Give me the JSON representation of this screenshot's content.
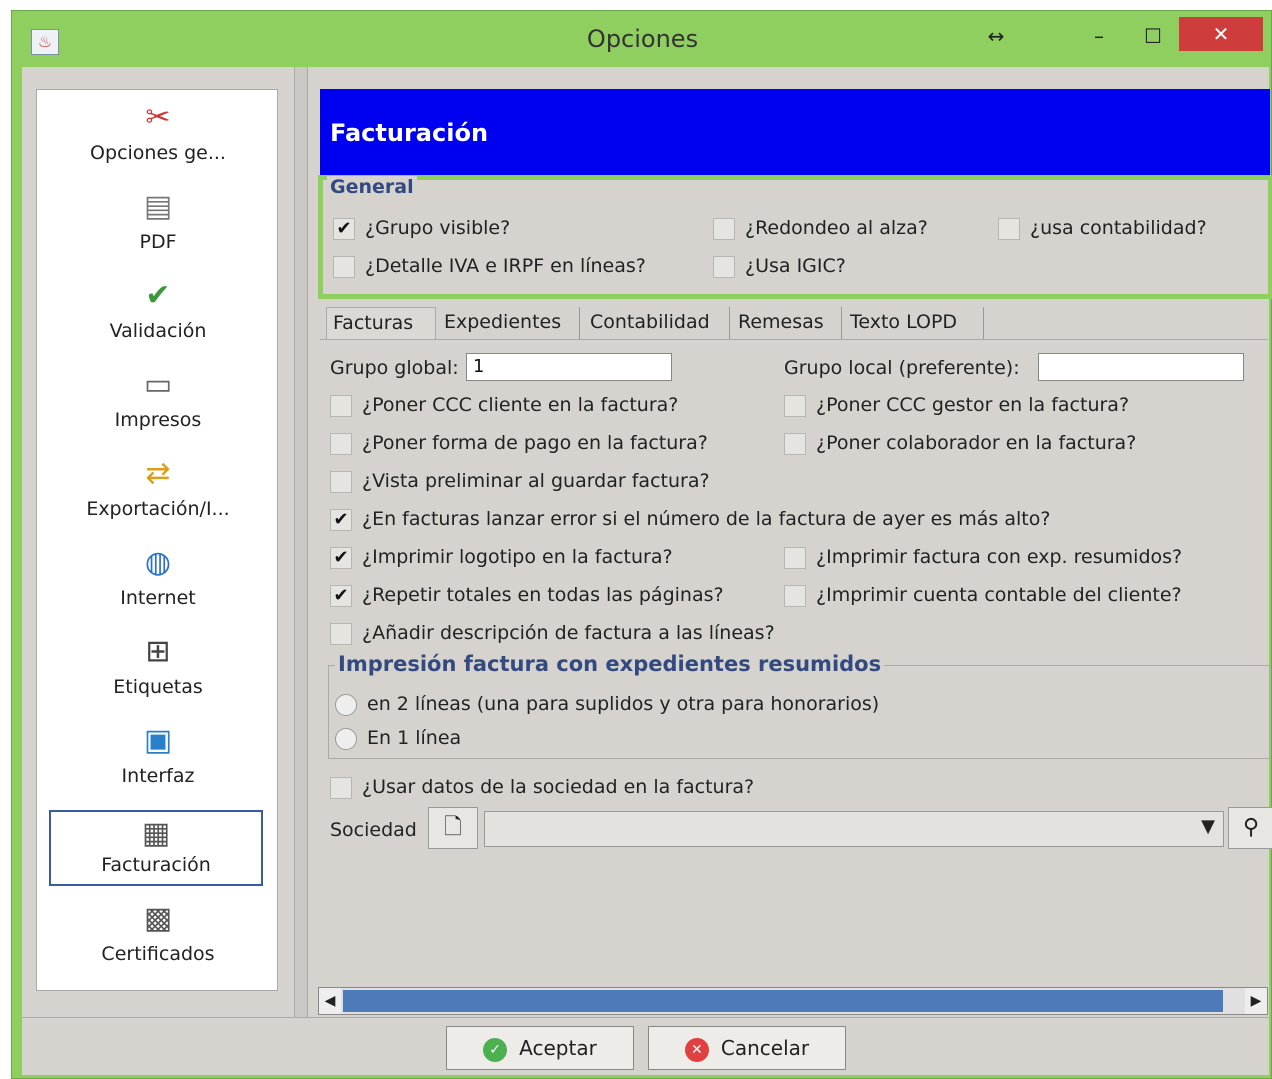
{
  "window": {
    "title": "Opciones",
    "close_glyph": "✕",
    "resize_glyph": "↔",
    "minimize_glyph": "–",
    "maximize_glyph": "☐"
  },
  "sidebar": {
    "items": [
      {
        "label": "Opciones ge...",
        "icon": "tools-icon",
        "glyph": "✂"
      },
      {
        "label": "PDF",
        "icon": "document-icon",
        "glyph": "▤"
      },
      {
        "label": "Validación",
        "icon": "checkmark-icon",
        "glyph": "✔"
      },
      {
        "label": "Impresos",
        "icon": "printer-icon",
        "glyph": "▭"
      },
      {
        "label": "Exportación/I...",
        "icon": "export-icon",
        "glyph": "⇄"
      },
      {
        "label": "Internet",
        "icon": "globe-icon",
        "glyph": "◍"
      },
      {
        "label": "Etiquetas",
        "icon": "label-icon",
        "glyph": "⊞"
      },
      {
        "label": "Interfaz",
        "icon": "interface-icon",
        "glyph": "▣"
      },
      {
        "label": "Facturación",
        "icon": "invoice-icon",
        "glyph": "▦"
      },
      {
        "label": "Certificados",
        "icon": "certificate-icon",
        "glyph": "▩"
      }
    ],
    "selected": "Facturación"
  },
  "banner": {
    "title": "Facturación"
  },
  "general": {
    "legend": "General",
    "grupo_visible": {
      "label": "¿Grupo visible?",
      "checked": true
    },
    "redondeo": {
      "label": "¿Redondeo al alza?",
      "checked": false
    },
    "usa_contabilidad": {
      "label": "¿usa contabilidad?",
      "checked": false
    },
    "detalle_iva": {
      "label": "¿Detalle IVA e IRPF en líneas?",
      "checked": false
    },
    "usa_igic": {
      "label": "¿Usa IGIC?",
      "checked": false
    }
  },
  "tabs": [
    "Facturas",
    "Expedientes",
    "Contabilidad",
    "Remesas",
    "Texto LOPD"
  ],
  "facturas": {
    "grupo_global_label": "Grupo global:",
    "grupo_global_value": "1",
    "grupo_local_label": "Grupo local (preferente):",
    "grupo_local_value": "",
    "ccc_cliente": "¿Poner CCC cliente en la factura?",
    "ccc_gestor": "¿Poner CCC gestor en la factura?",
    "forma_pago": "¿Poner forma de pago en la factura?",
    "colaborador": "¿Poner colaborador en la factura?",
    "vista_preliminar": "¿Vista preliminar al guardar factura?",
    "lanzar_error": "¿En facturas lanzar error si el número de la factura de ayer es más alto?",
    "imprimir_logotipo": "¿Imprimir logotipo en la factura?",
    "imprimir_exp_resumidos": "¿Imprimir factura con exp. resumidos?",
    "repetir_totales": "¿Repetir totales en todas las páginas?",
    "imprimir_cuenta": "¿Imprimir cuenta contable del cliente?",
    "anadir_descripcion": "¿Añadir descripción de factura a las líneas?",
    "impresion_legend": "Impresión factura con expedientes resumidos",
    "radio_2_lineas": "en 2 líneas (una para suplidos y otra para honorarios)",
    "radio_1_linea": "En 1 línea",
    "usar_datos_sociedad": "¿Usar datos de la sociedad en la factura?",
    "sociedad_label": "Sociedad",
    "check_mark": "✔"
  },
  "buttons": {
    "accept": "Aceptar",
    "cancel": "Cancelar"
  }
}
